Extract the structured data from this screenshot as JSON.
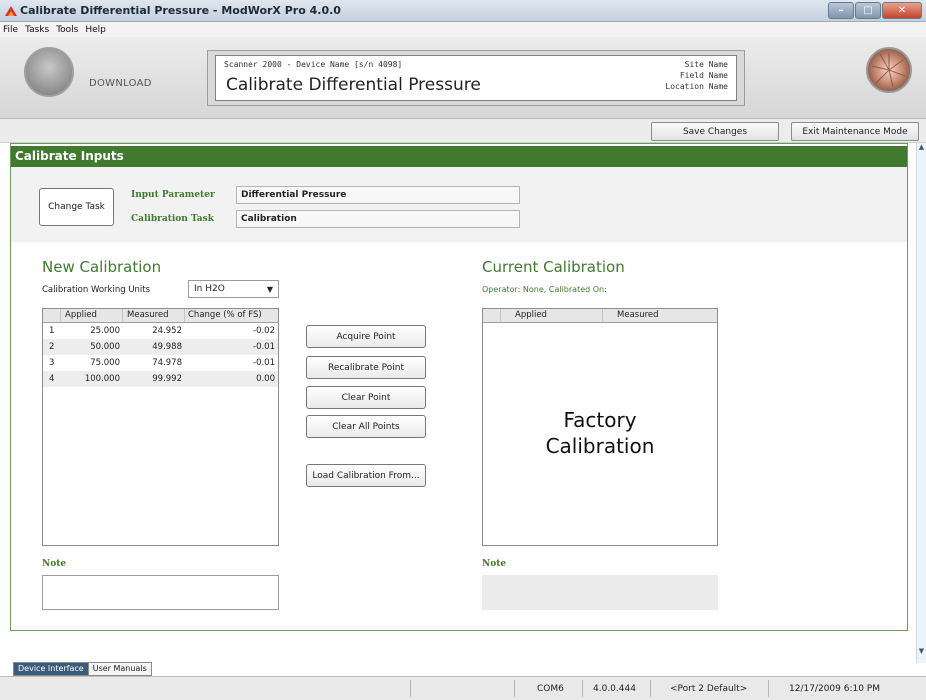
{
  "window": {
    "title": "Calibrate Differential Pressure - ModWorX Pro 4.0.0",
    "controls": {
      "minimize": "–",
      "maximize": "□",
      "close": "✕"
    }
  },
  "menu": [
    "File",
    "Tasks",
    "Tools",
    "Help"
  ],
  "header": {
    "download_label": "DOWNLOAD",
    "device_name": "Scanner 2000 - Device Name [s/n 4098]",
    "screen_title": "Calibrate Differential Pressure",
    "site_name": "Site Name",
    "field_name": "Field Name",
    "location_name": "Location Name"
  },
  "actions": {
    "save": "Save Changes",
    "exit": "Exit Maintenance Mode"
  },
  "section": {
    "title": "Calibrate Inputs",
    "change_task": "Change Task",
    "input_parameter_label": "Input Parameter",
    "input_parameter_value": "Differential Pressure",
    "calibration_task_label": "Calibration Task",
    "calibration_task_value": "Calibration"
  },
  "new_calibration": {
    "title": "New Calibration",
    "units_label": "Calibration Working Units",
    "units_value": "In H2O",
    "columns": [
      "Applied",
      "Measured",
      "Change (% of FS)"
    ],
    "rows": [
      {
        "idx": "1",
        "applied": "25.000",
        "measured": "24.952",
        "change": "-0.02"
      },
      {
        "idx": "2",
        "applied": "50.000",
        "measured": "49.988",
        "change": "-0.01"
      },
      {
        "idx": "3",
        "applied": "75.000",
        "measured": "74.978",
        "change": "-0.01"
      },
      {
        "idx": "4",
        "applied": "100.000",
        "measured": "99.992",
        "change": "0.00"
      }
    ],
    "note_label": "Note"
  },
  "buttons": {
    "acquire": "Acquire Point",
    "recalibrate": "Recalibrate Point",
    "clear": "Clear Point",
    "clear_all": "Clear All Points",
    "load": "Load Calibration From..."
  },
  "current_calibration": {
    "title": "Current Calibration",
    "operator_line": "Operator: None, Calibrated On:",
    "columns": [
      "Applied",
      "Measured"
    ],
    "factory_line1": "Factory",
    "factory_line2": "Calibration",
    "note_label": "Note"
  },
  "bottom_tabs": [
    "Device Interface",
    "User Manuals"
  ],
  "status": {
    "port": "COM6",
    "version": "4.0.0.444",
    "port_setting": "<Port 2 Default>",
    "datetime": "12/17/2009 6:10 PM"
  },
  "colors": {
    "accent_green": "#3f7a2e"
  }
}
